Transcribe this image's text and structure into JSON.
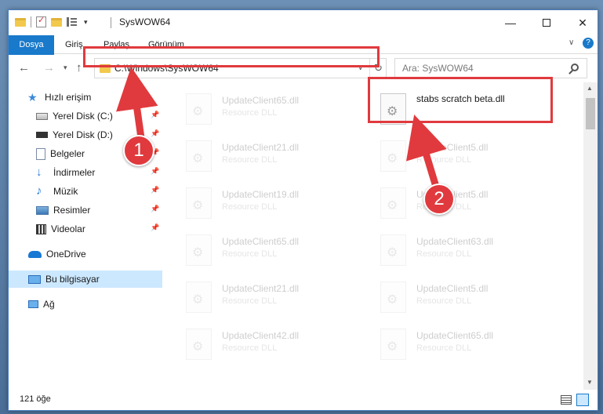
{
  "window": {
    "title": "SysWOW64",
    "buttons": {
      "minimize": "—",
      "maximize": "",
      "close": "✕"
    }
  },
  "ribbon": {
    "file_tab": "Dosya",
    "tabs": [
      "Giriş",
      "Paylaş",
      "Görünüm"
    ],
    "help": "?",
    "expand": "∨"
  },
  "nav": {
    "back": "←",
    "forward": "→",
    "recent": "▾",
    "up": "↑",
    "address": "C:\\Windows\\SysWOW64",
    "address_dropdown": "∨",
    "refresh": "↻",
    "search_placeholder": "Ara: SysWOW64"
  },
  "sidebar": {
    "items": [
      {
        "label": "Hızlı erişim",
        "icon": "star-icon"
      },
      {
        "label": "Yerel Disk (C:)",
        "icon": "drive-icon",
        "pinned": true
      },
      {
        "label": "Yerel Disk (D:)",
        "icon": "drive-icon",
        "pinned": true
      },
      {
        "label": "Belgeler",
        "icon": "documents-icon",
        "pinned": true
      },
      {
        "label": "İndirmeler",
        "icon": "download-icon",
        "pinned": true
      },
      {
        "label": "Müzik",
        "icon": "music-icon",
        "pinned": true
      },
      {
        "label": "Resimler",
        "icon": "pictures-icon",
        "pinned": true
      },
      {
        "label": "Videolar",
        "icon": "videos-icon",
        "pinned": true
      },
      {
        "label": "OneDrive",
        "icon": "onedrive-icon"
      },
      {
        "label": "Bu bilgisayar",
        "icon": "computer-icon",
        "selected": true
      },
      {
        "label": "Ağ",
        "icon": "network-icon"
      }
    ],
    "pin_glyph": "📌"
  },
  "files": {
    "left": [
      {
        "name": "UpdateClient65.dll",
        "type": "Resource DLL"
      },
      {
        "name": "UpdateClient21.dll",
        "type": "Resource DLL"
      },
      {
        "name": "UpdateClient19.dll",
        "type": "Resource DLL"
      },
      {
        "name": "UpdateClient65.dll",
        "type": "Resource DLL"
      },
      {
        "name": "UpdateClient21.dll",
        "type": "Resource DLL"
      },
      {
        "name": "UpdateClient42.dll",
        "type": "Resource DLL"
      }
    ],
    "right": [
      {
        "name": "stabs scratch beta.dll",
        "type": ""
      },
      {
        "name": "UpdateClient5.dll",
        "type": "Resource DLL"
      },
      {
        "name": "UpdateClient5.dll",
        "type": "Resource DLL"
      },
      {
        "name": "UpdateClient63.dll",
        "type": "Resource DLL"
      },
      {
        "name": "UpdateClient5.dll",
        "type": "Resource DLL"
      },
      {
        "name": "UpdateClient65.dll",
        "type": "Resource DLL"
      }
    ]
  },
  "status": {
    "count": "121 öğe"
  },
  "annotations": {
    "step1": "1",
    "step2": "2",
    "color": "#e03a3e"
  }
}
